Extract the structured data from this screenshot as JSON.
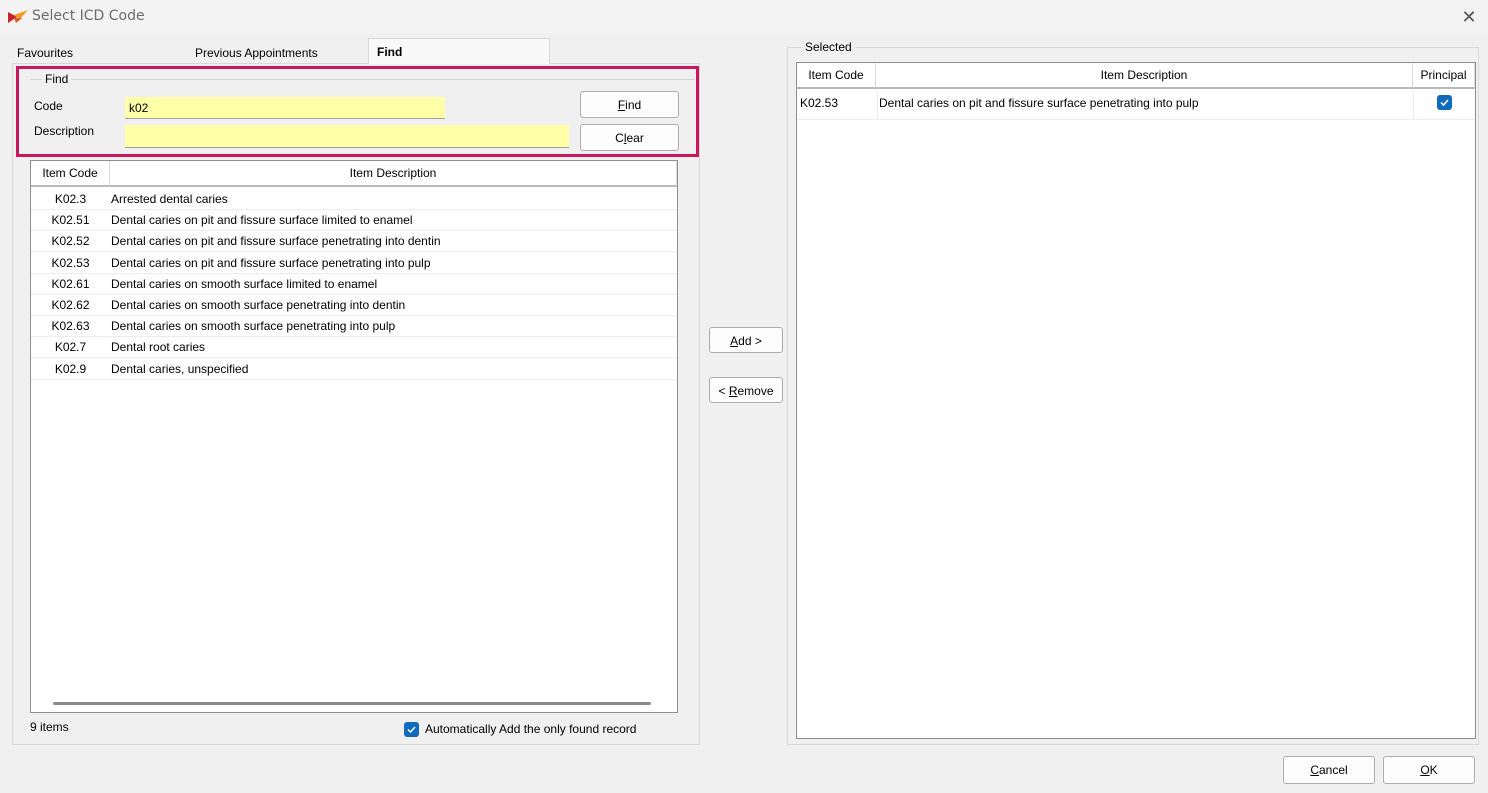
{
  "window": {
    "title": "Select ICD Code"
  },
  "tabs": {
    "favourites": "Favourites",
    "previous": "Previous Appointments",
    "find": "Find"
  },
  "find_group": {
    "legend": "Find",
    "code_label": "Code",
    "code_value": "k02",
    "description_label": "Description",
    "description_value": "",
    "find_button": {
      "pre": "",
      "accel": "F",
      "post": "ind"
    },
    "clear_button": {
      "pre": "C",
      "accel": "l",
      "post": "ear"
    }
  },
  "results": {
    "columns": {
      "code": "Item Code",
      "description": "Item Description"
    },
    "rows": [
      {
        "code": "K02.3",
        "description": "Arrested dental caries"
      },
      {
        "code": "K02.51",
        "description": "Dental caries on pit and fissure surface limited to enamel"
      },
      {
        "code": "K02.52",
        "description": "Dental caries on pit and fissure surface penetrating into dentin"
      },
      {
        "code": "K02.53",
        "description": "Dental caries on pit and fissure surface penetrating into pulp"
      },
      {
        "code": "K02.61",
        "description": "Dental caries on smooth surface limited to enamel"
      },
      {
        "code": "K02.62",
        "description": "Dental caries on smooth surface penetrating into dentin"
      },
      {
        "code": "K02.63",
        "description": "Dental caries on smooth surface penetrating into pulp"
      },
      {
        "code": "K02.7",
        "description": "Dental root caries"
      },
      {
        "code": "K02.9",
        "description": "Dental caries, unspecified"
      }
    ],
    "count_text": "9 items",
    "auto_add_label": "Automatically Add the only found record",
    "auto_add_checked": true
  },
  "middle": {
    "add_button": {
      "pre": "",
      "accel": "A",
      "post": "dd >"
    },
    "remove_button": {
      "pre": "< ",
      "accel": "R",
      "post": "emove"
    }
  },
  "selected": {
    "legend": "Selected",
    "columns": {
      "code": "Item Code",
      "description": "Item Description",
      "principal": "Principal"
    },
    "rows": [
      {
        "code": "K02.53",
        "description": "Dental caries on pit and fissure surface penetrating into pulp",
        "principal": true
      }
    ]
  },
  "footer": {
    "cancel_button": {
      "pre": "",
      "accel": "C",
      "post": "ancel"
    },
    "ok_button": {
      "pre": "",
      "accel": "O",
      "post": "K"
    }
  },
  "colors": {
    "accent": "#0f6cbd",
    "highlight": "#c8175d",
    "input_bg": "#ffffa8"
  }
}
